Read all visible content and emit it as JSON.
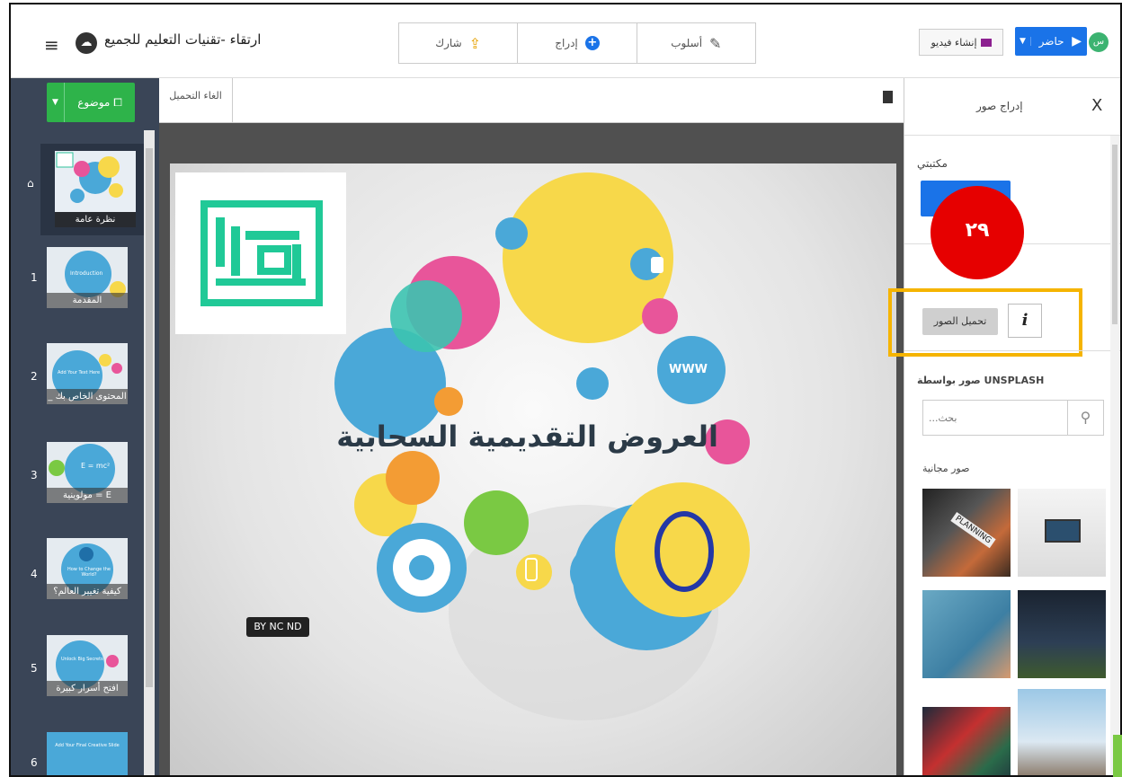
{
  "app": {
    "presentation_title": "ارتقاء -تقنيات التعليم للجميع"
  },
  "toolbar": {
    "style_label": "أسلوب",
    "insert_label": "إدراج",
    "share_label": "شارك",
    "create_video_label": "إنشاء فيديو",
    "present_label": "حاضر",
    "avatar_initial": "س"
  },
  "left_panel": {
    "topic_label": "موضوع",
    "overview_caption": "نظرة عامة",
    "slides": [
      {
        "number": "1",
        "caption": "المقدمة",
        "thumb_text": "Introduction"
      },
      {
        "number": "2",
        "caption": "_ المحتوى الخاص بك",
        "thumb_text": "Add Your Text Here"
      },
      {
        "number": "3",
        "caption": "مولوينية = E",
        "thumb_text": "E = mc²"
      },
      {
        "number": "4",
        "caption": "كيفية تغيير العالم؟",
        "thumb_text": "How to Change the World?"
      },
      {
        "number": "5",
        "caption": "افتح أسرار كبيرة",
        "thumb_text": "Unlock Big Secrets"
      },
      {
        "number": "6",
        "caption": "",
        "thumb_text": "Add Your Final Creative Slide"
      }
    ]
  },
  "canvas": {
    "undo_label": "الغاء التحميل",
    "slide_title": "العروض التقديمية السحابية",
    "cc_badge": "BY NC ND",
    "www_label": "WWW"
  },
  "right_panel": {
    "header_title": "إدراج صور",
    "close_label": "X",
    "library_label": "مكتبتي",
    "annotation_number": "٢٩",
    "upload_label": "تحميل الصور",
    "info_label": "i",
    "unsplash_label": "UNSPLASH صور بواسطة",
    "search_placeholder": "...بحث",
    "free_pictures_label": "صور مجانية",
    "planning_text": "PLANNING"
  },
  "colors": {
    "present_blue": "#1a73e8",
    "topic_green": "#2eb34a",
    "annotation_red": "#e60000",
    "highlight_yellow": "#f5b400",
    "left_panel_bg": "#3a4557"
  }
}
